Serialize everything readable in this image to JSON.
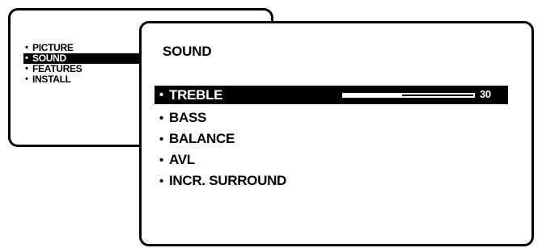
{
  "main_menu": {
    "items": [
      {
        "label": "PICTURE",
        "selected": false
      },
      {
        "label": "SOUND",
        "selected": true
      },
      {
        "label": "FEATURES",
        "selected": false
      },
      {
        "label": "INSTALL",
        "selected": false
      }
    ]
  },
  "sound_menu": {
    "title": "SOUND",
    "items": [
      {
        "label": "TREBLE",
        "selected": true
      },
      {
        "label": "BASS",
        "selected": false
      },
      {
        "label": "BALANCE",
        "selected": false
      },
      {
        "label": "AVL",
        "selected": false
      },
      {
        "label": "INCR. SURROUND",
        "selected": false
      }
    ],
    "treble_level": {
      "value": "30",
      "fraction": 0.45
    }
  },
  "bullet_glyph": "•",
  "colors": {
    "background": "#ffffff",
    "foreground": "#000000",
    "highlight_bg": "#000000",
    "highlight_fg": "#ffffff"
  }
}
